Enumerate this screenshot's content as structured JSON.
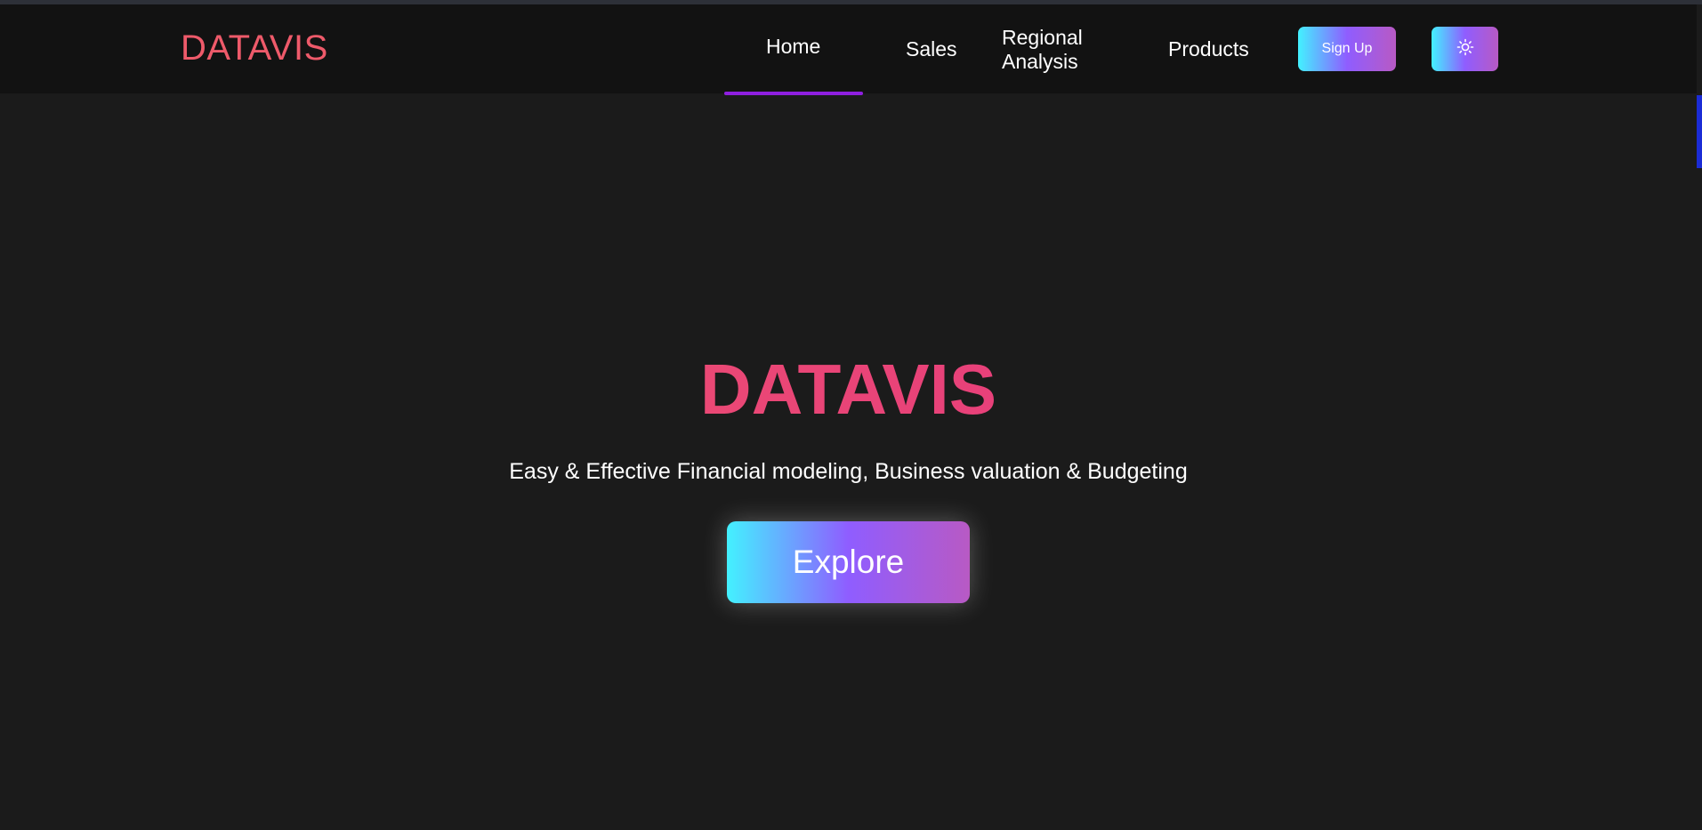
{
  "navbar": {
    "logo": "DATAVIS",
    "items": [
      {
        "label": "Home",
        "active": true
      },
      {
        "label": "Sales"
      },
      {
        "label": "Regional Analysis"
      },
      {
        "label": "Products"
      }
    ],
    "signup_label": "Sign Up",
    "theme_toggle_icon": "sun-icon"
  },
  "hero": {
    "title": "DATAVIS",
    "subtitle": "Easy & Effective Financial modeling, Business valuation & Budgeting",
    "cta_label": "Explore"
  },
  "colors": {
    "background": "#1b1b1b",
    "navbar": "#121212",
    "logo": "#ee5a6a",
    "active_underline": "#8f1fe0",
    "gradient_start": "#43f1ff",
    "gradient_mid": "#8f5dff",
    "gradient_end": "#b85ac4"
  }
}
